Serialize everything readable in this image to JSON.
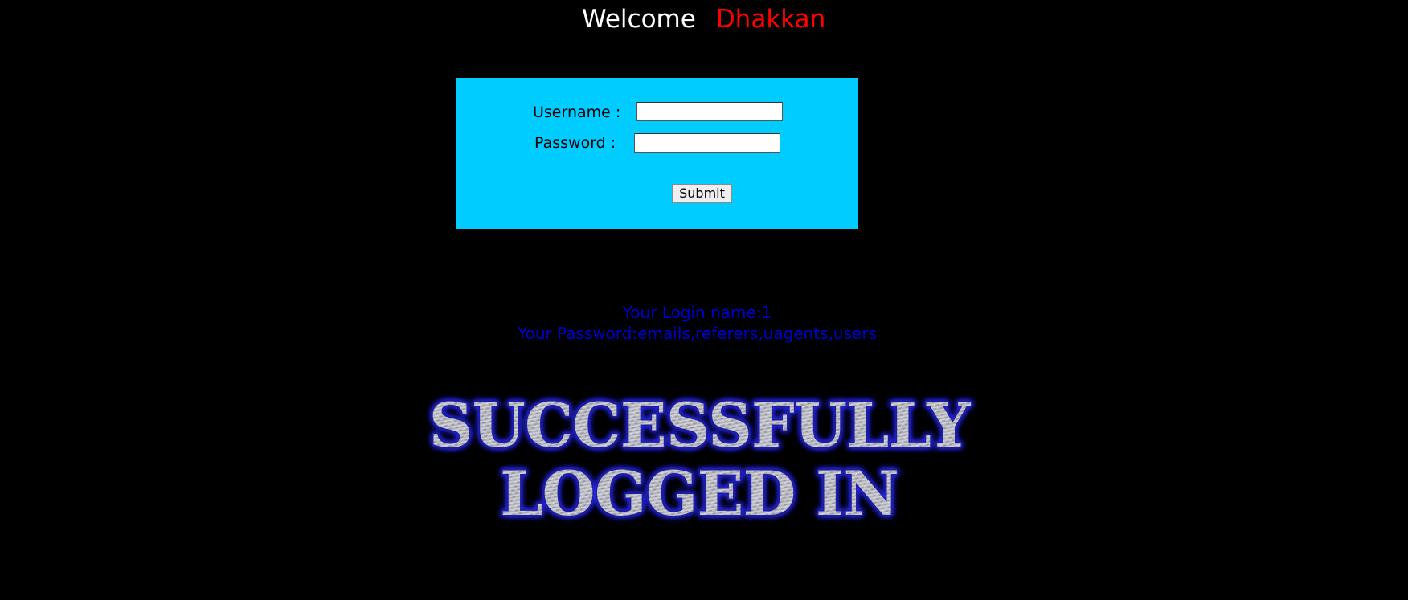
{
  "header": {
    "welcome_word": "Welcome",
    "user_name": "Dhakkan"
  },
  "login_form": {
    "username_label": "Username :",
    "password_label": "Password :",
    "username_value": "",
    "password_value": "",
    "submit_label": "Submit"
  },
  "result": {
    "login_name_line": "Your Login name:1",
    "password_line": "Your Password:emails,referers,uagents,users"
  },
  "banner": {
    "line1": "SUCCESSFULLY",
    "line2": "LOGGED IN"
  },
  "colors": {
    "background": "#000000",
    "form_background": "#00ccff",
    "accent_name": "#ff0000",
    "result_text": "#0000cc",
    "banner_glow": "#2020ff"
  }
}
